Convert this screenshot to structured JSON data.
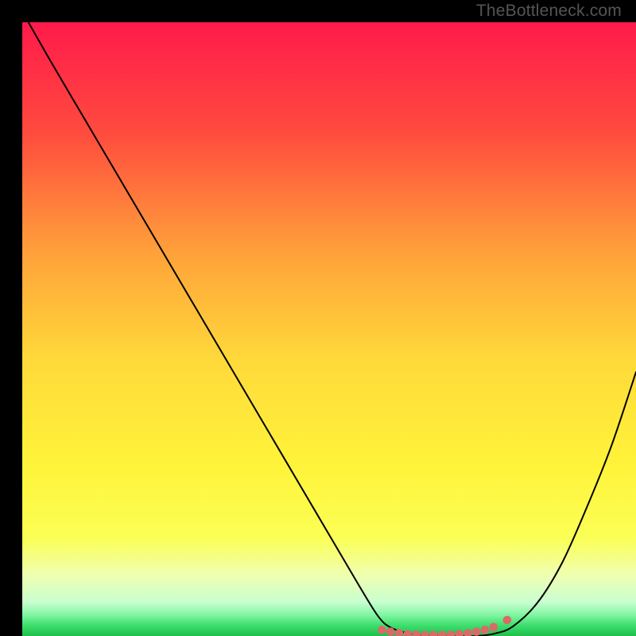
{
  "watermark": "TheBottleneck.com",
  "chart_data": {
    "type": "line",
    "title": "",
    "xlabel": "",
    "ylabel": "",
    "xlim": [
      0,
      100
    ],
    "ylim": [
      0,
      100
    ],
    "background_gradient": {
      "stops": [
        {
          "offset": 0.0,
          "color": "#ff1a4b"
        },
        {
          "offset": 0.18,
          "color": "#ff4b3e"
        },
        {
          "offset": 0.38,
          "color": "#ffa33a"
        },
        {
          "offset": 0.55,
          "color": "#ffd93a"
        },
        {
          "offset": 0.72,
          "color": "#fff33a"
        },
        {
          "offset": 0.84,
          "color": "#fbff55"
        },
        {
          "offset": 0.9,
          "color": "#f0ffb0"
        },
        {
          "offset": 0.945,
          "color": "#c8ffd0"
        },
        {
          "offset": 0.966,
          "color": "#80f5a0"
        },
        {
          "offset": 0.982,
          "color": "#3fe070"
        },
        {
          "offset": 1.0,
          "color": "#1fbf4a"
        }
      ]
    },
    "series": [
      {
        "name": "curve",
        "color": "#000000",
        "width": 2,
        "x": [
          1,
          5,
          10,
          15,
          20,
          25,
          30,
          35,
          40,
          45,
          50,
          55,
          58,
          60,
          63,
          66,
          70,
          74,
          77,
          80,
          84,
          88,
          92,
          96,
          100
        ],
        "y": [
          100,
          93,
          84.5,
          76,
          67.5,
          59,
          50.5,
          42,
          33.5,
          25,
          16.5,
          8,
          3.2,
          1.4,
          0.4,
          0.0,
          0.0,
          0.0,
          0.4,
          1.6,
          5.5,
          12,
          21,
          31,
          43
        ]
      }
    ],
    "markers": [
      {
        "name": "flat-segment",
        "color": "#d96a68",
        "radius": 5.3,
        "x": [
          58.6,
          60.0,
          61.4,
          62.8,
          64.2,
          65.6,
          67.0,
          68.4,
          69.8,
          71.2,
          72.6,
          74.0,
          75.4,
          76.8
        ],
        "y": [
          1.0,
          0.7,
          0.45,
          0.3,
          0.2,
          0.15,
          0.15,
          0.15,
          0.2,
          0.3,
          0.45,
          0.7,
          1.0,
          1.45
        ]
      },
      {
        "name": "lone-dot",
        "color": "#d96a68",
        "radius": 5.3,
        "x": [
          79.0
        ],
        "y": [
          2.6
        ]
      }
    ]
  }
}
